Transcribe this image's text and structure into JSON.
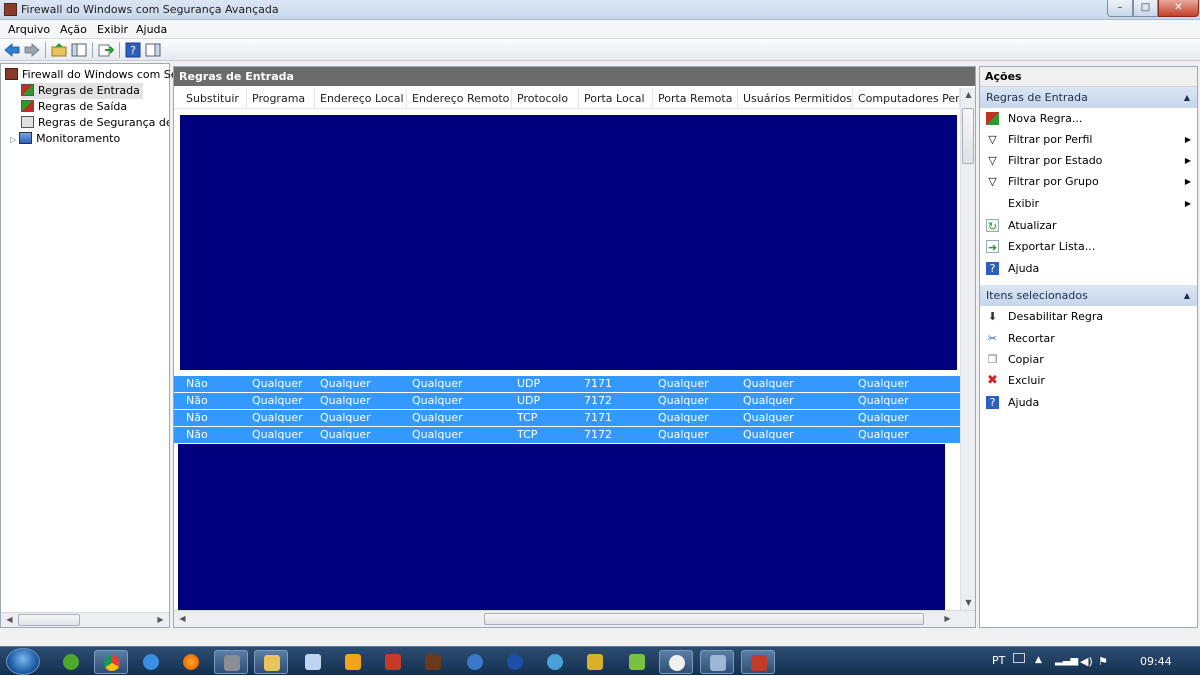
{
  "window": {
    "title": "Firewall do Windows com Segurança Avançada"
  },
  "menu": [
    "Arquivo",
    "Ação",
    "Exibir",
    "Ajuda"
  ],
  "tree": {
    "root": "Firewall do Windows com Segu",
    "items": [
      "Regras de Entrada",
      "Regras de Saída",
      "Regras de Segurança de Co",
      "Monitoramento"
    ]
  },
  "center": {
    "title": "Regras de Entrada",
    "columns": [
      "Substituir",
      "Programa",
      "Endereço Local",
      "Endereço Remoto",
      "Protocolo",
      "Porta Local",
      "Porta Remota",
      "Usuários Permitidos",
      "Computadores Permit"
    ],
    "selected_rows": [
      [
        "Não",
        "Qualquer",
        "Qualquer",
        "Qualquer",
        "UDP",
        "7171",
        "Qualquer",
        "Qualquer",
        "Qualquer"
      ],
      [
        "Não",
        "Qualquer",
        "Qualquer",
        "Qualquer",
        "UDP",
        "7172",
        "Qualquer",
        "Qualquer",
        "Qualquer"
      ],
      [
        "Não",
        "Qualquer",
        "Qualquer",
        "Qualquer",
        "TCP",
        "7171",
        "Qualquer",
        "Qualquer",
        "Qualquer"
      ],
      [
        "Não",
        "Qualquer",
        "Qualquer",
        "Qualquer",
        "TCP",
        "7172",
        "Qualquer",
        "Qualquer",
        "Qualquer"
      ]
    ]
  },
  "actions": {
    "title": "Ações",
    "section1": {
      "title": "Regras de Entrada",
      "items": [
        "Nova Regra...",
        "Filtrar por Perfil",
        "Filtrar por Estado",
        "Filtrar por Grupo",
        "Exibir",
        "Atualizar",
        "Exportar Lista...",
        "Ajuda"
      ]
    },
    "section2": {
      "title": "Itens selecionados",
      "items": [
        "Desabilitar Regra",
        "Recortar",
        "Copiar",
        "Excluir",
        "Ajuda"
      ]
    }
  },
  "tray": {
    "lang": "PT",
    "time": "09:44"
  },
  "colors": {
    "selection": "#3399ff",
    "redaction": "#00007f",
    "header": "#6b6b6b"
  }
}
